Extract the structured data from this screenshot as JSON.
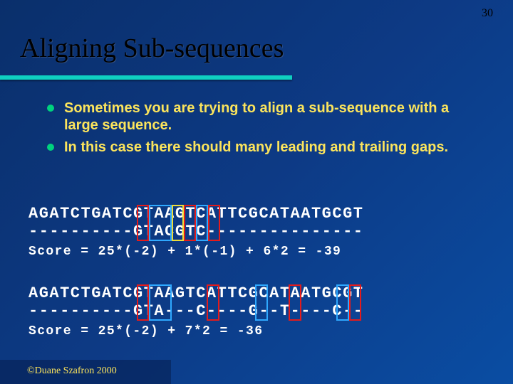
{
  "slide_number": "30",
  "title": "Aligning Sub-sequences",
  "bullets": [
    "Sometimes you are trying to align a sub-sequence with a large sequence.",
    "In this case there should many leading and trailing gaps."
  ],
  "alignment1": {
    "line1": "AGATCTGATCGTAAGTCATTCGCATAATGCGT",
    "line2": "----------GTACGTC---------------",
    "score": "Score = 25*(-2) + 1*(-1) + 6*2 = -39"
  },
  "alignment2": {
    "line1": "AGATCTGATCGTAAGTCATTCGCATAATGCGT",
    "line2": "----------GTA---C----G--T----C--",
    "score": "Score = 25*(-2) + 7*2 = -36"
  },
  "footer": "©Duane Szafron 2000"
}
